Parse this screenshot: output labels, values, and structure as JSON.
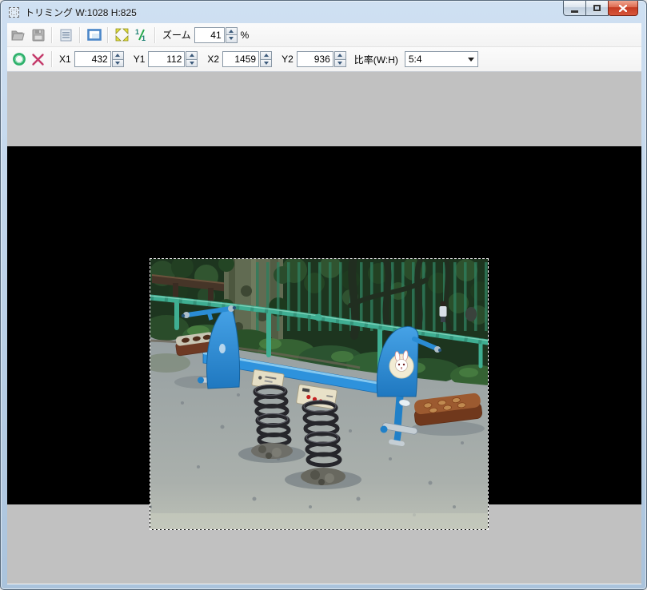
{
  "window": {
    "title": "トリミング W:1028 H:825"
  },
  "toolbar1": {
    "zoom_label": "ズーム",
    "zoom_value": "41",
    "zoom_unit": "%"
  },
  "toolbar2": {
    "x1_label": "X1",
    "x1_value": "432",
    "y1_label": "Y1",
    "y1_value": "112",
    "x2_label": "X2",
    "x2_value": "1459",
    "y2_label": "Y2",
    "y2_value": "936",
    "ratio_label": "比率(W:H)",
    "ratio_value": "5:4"
  },
  "colors": {
    "titlebar": "#c2d6ea",
    "toolbar_bg": "#f7f7f7",
    "canvas_bg": "#c1c1c1",
    "viewport_bg": "#000000",
    "selection_dash": "#ffffff",
    "close_button": "#cf4130",
    "accent_blue_icon": "#4a86c8",
    "apply_green": "#2cb06a",
    "cancel_red": "#c43a6a",
    "seesaw_blue": "#2e92dc"
  }
}
